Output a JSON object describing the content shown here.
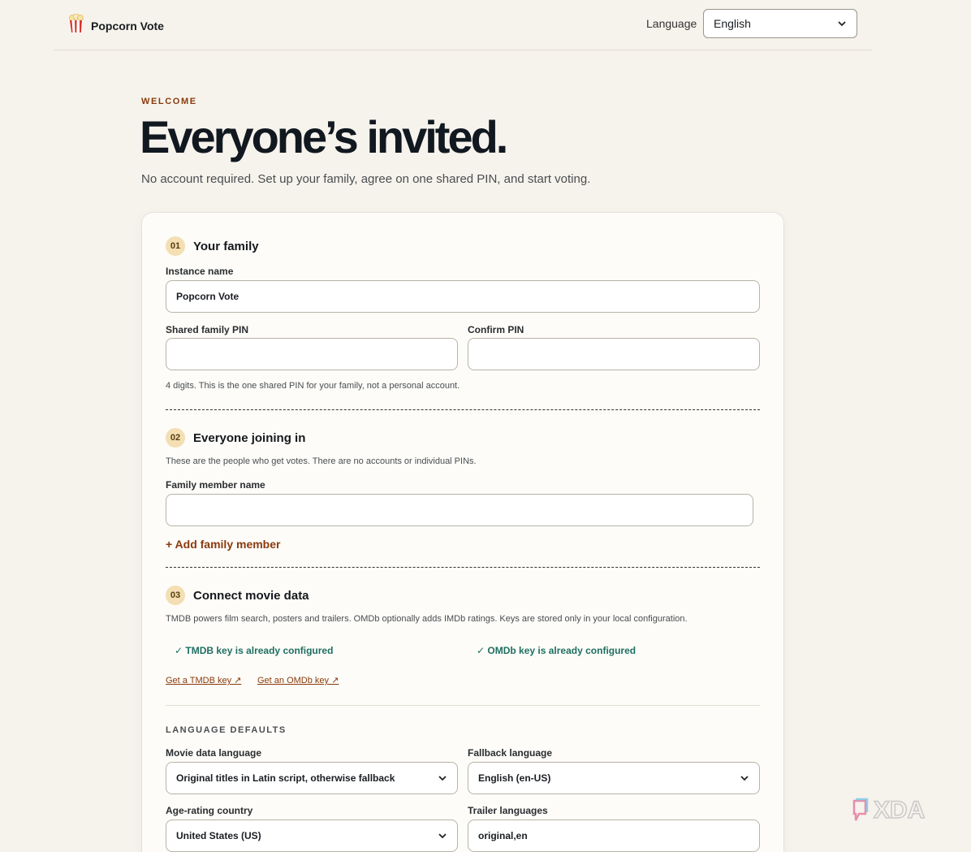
{
  "header": {
    "brand": "Popcorn Vote",
    "language_label": "Language",
    "language_value": "English"
  },
  "hero": {
    "eyebrow": "WELCOME",
    "title": "Everyone’s invited.",
    "subtitle": "No account required. Set up your family, agree on one shared PIN, and start voting."
  },
  "section1": {
    "num": "01",
    "title": "Your family",
    "instance_label": "Instance name",
    "instance_value": "Popcorn Vote",
    "pin_label": "Shared family PIN",
    "pin_value": "",
    "confirm_label": "Confirm PIN",
    "confirm_value": "",
    "pin_hint": "4 digits. This is the one shared PIN for your family, not a personal account."
  },
  "section2": {
    "num": "02",
    "title": "Everyone joining in",
    "desc": "These are the people who get votes. There are no accounts or individual PINs.",
    "member_label": "Family member name",
    "member_value": "",
    "add_label": "+ Add family member"
  },
  "section3": {
    "num": "03",
    "title": "Connect movie data",
    "desc": "TMDB powers film search, posters and trailers. OMDb optionally adds IMDb ratings. Keys are stored only in your local configuration.",
    "tmdb_status": "✓ TMDB key is already configured",
    "omdb_status": "✓ OMDb key is already configured",
    "tmdb_link": "Get a TMDB key ↗",
    "omdb_link": "Get an OMDb key ↗"
  },
  "language_defaults": {
    "heading": "LANGUAGE DEFAULTS",
    "movie_lang_label": "Movie data language",
    "movie_lang_value": "Original titles in Latin script, otherwise fallback",
    "fallback_label": "Fallback language",
    "fallback_value": "English (en-US)",
    "age_label": "Age-rating country",
    "age_value": "United States (US)",
    "trailer_label": "Trailer languages",
    "trailer_value": "original,en"
  },
  "watermark": {
    "text": "XDA"
  },
  "colors": {
    "background": "#f6f3ec",
    "accent": "#8a3a0d",
    "success": "#1f6f62",
    "badge": "#f3dfb3"
  }
}
